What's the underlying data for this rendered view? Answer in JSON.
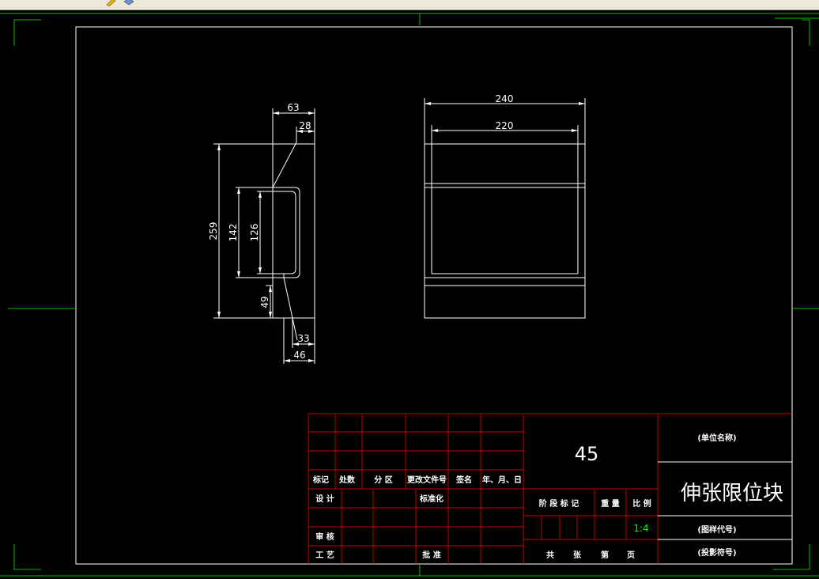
{
  "toolbar": {
    "icons": [
      "pencil-icon",
      "layers-icon"
    ]
  },
  "colors": {
    "background": "#000000",
    "lines": "#ffffff",
    "border_marks": "#00c000",
    "title_block": "#c00000",
    "scale_text": "#00ff00"
  },
  "dimensions": {
    "d63": "63",
    "d28": "28",
    "d259": "259",
    "d142": "142",
    "d126": "126",
    "d49": "49",
    "d33": "33",
    "d46": "46",
    "d240": "240",
    "d220": "220"
  },
  "title_block": {
    "material": "45",
    "unit_name": "(单位名称)",
    "part_name": "伸张限位块",
    "drawing_code": "(图样代号)",
    "projection_symbol": "(投影符号)",
    "scale": "1:4",
    "mark": "标记",
    "count": "处数",
    "zone": "分 区",
    "change_doc": "更改文件号",
    "signature": "签名",
    "date": "年、月、日",
    "design": "设 计",
    "standardization": "标准化",
    "review": "审 核",
    "process": "工 艺",
    "approve": "批 准",
    "stage_mark": "阶 段 标 记",
    "weight": "重 量",
    "ratio": "比 例",
    "total_sheets": "共",
    "sheet_word": "张",
    "sheet_no": "第",
    "page_word": "页"
  }
}
